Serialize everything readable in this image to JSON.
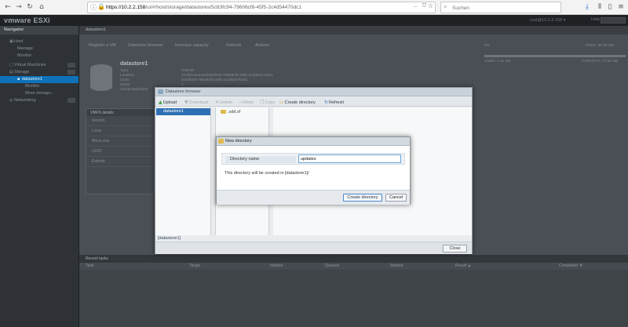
{
  "browser": {
    "url_host": "https://10.2.2.158",
    "url_path": "/ui/#/host/storage/datastores/5c83fc94-79606cf8-45f5-2c4d54470dc1",
    "url_more": "...",
    "search_placeholder": "Suchen"
  },
  "esxi": {
    "logo": "vmware ESXi",
    "user": "root@10.2.2.158 ▾",
    "help": "Help ▾"
  },
  "navigator": {
    "title": "Navigator",
    "items": [
      {
        "label": "Host"
      },
      {
        "label": "Manage"
      },
      {
        "label": "Monitor"
      },
      {
        "label": "Virtual Machines"
      },
      {
        "label": "Storage"
      },
      {
        "label": "datastore1"
      },
      {
        "label": "Monitor"
      },
      {
        "label": "More storage..."
      },
      {
        "label": "Networking"
      }
    ]
  },
  "main": {
    "title": "datastore1",
    "toolbar": [
      "Register a VM",
      "Datastore browser",
      "Increase capacity",
      "Refresh",
      "Actions"
    ],
    "ds_name": "datastore1",
    "props": [
      {
        "k": "Type",
        "v": "VMFS6"
      },
      {
        "k": "Location",
        "v": "/vmfs/volumes/5c83fc94-79606cf8-45f5-2c4d54470dc1"
      },
      {
        "k": "UUID",
        "v": "5c83fc94-79606cf8-45f5-2c4d54470dc1"
      },
      {
        "k": "Hosts",
        "v": "1"
      },
      {
        "k": "Virtual Machines",
        "v": "0"
      }
    ],
    "usage_used": "USED: 1.41 GB",
    "usage_free": "FREE: 26.09 GB",
    "usage_cap": "CAPACITY: 27.50 GB",
    "usage_pct": "5%",
    "vmfs": {
      "title": "VMFS details",
      "rows": [
        "Version",
        "Local",
        "Block size",
        "UUID",
        "Extents"
      ]
    },
    "tasks": {
      "title": "Recent tasks",
      "cols": [
        "Task",
        "Target",
        "Initiator",
        "Queued",
        "Started",
        "Result ▲",
        "Completed ▼"
      ]
    }
  },
  "ds_browser": {
    "title": "Datastore browser",
    "toolbar": {
      "upload": "Upload",
      "download": "Download",
      "delete": "Delete",
      "move": "Move",
      "copy": "Copy",
      "create_dir": "Create directory",
      "refresh": "Refresh"
    },
    "datastore": "datastore1",
    "folder": ".sdd.sf",
    "path": "[datastore1]",
    "close": "Close"
  },
  "new_dir": {
    "title": "New directory",
    "label": "Directory name",
    "value": "updates",
    "info": "This directory will be created in [datastore1]/",
    "create": "Create directory",
    "cancel": "Cancel"
  }
}
